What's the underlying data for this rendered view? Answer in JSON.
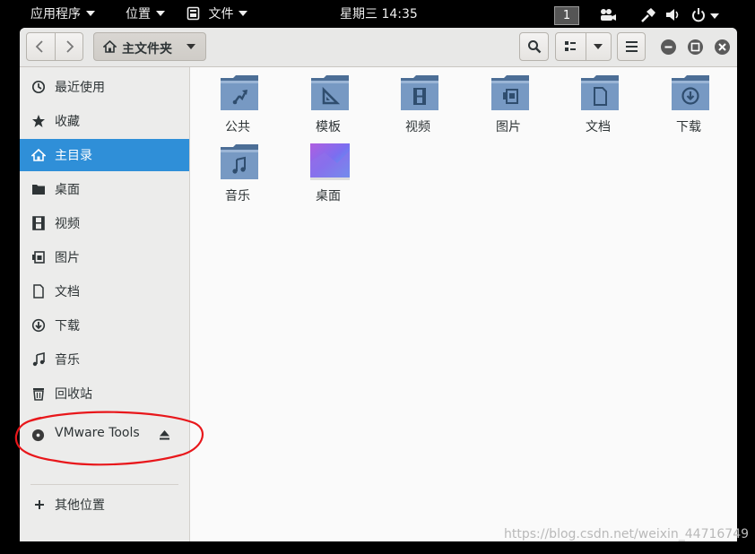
{
  "topbar": {
    "applications": "应用程序",
    "places": "位置",
    "files_app": "文件",
    "clock": "星期三 14:35",
    "workspace": "1"
  },
  "headerbar": {
    "path_label": "主文件夹"
  },
  "sidebar": {
    "items": [
      {
        "label": "最近使用",
        "icon": "clock-icon"
      },
      {
        "label": "收藏",
        "icon": "star-icon"
      },
      {
        "label": "主目录",
        "icon": "home-icon"
      },
      {
        "label": "桌面",
        "icon": "folder-icon"
      },
      {
        "label": "视频",
        "icon": "film-icon"
      },
      {
        "label": "图片",
        "icon": "picture-icon"
      },
      {
        "label": "文档",
        "icon": "document-icon"
      },
      {
        "label": "下载",
        "icon": "download-icon"
      },
      {
        "label": "音乐",
        "icon": "music-icon"
      },
      {
        "label": "回收站",
        "icon": "trash-icon"
      }
    ],
    "device": {
      "label": "VMware Tools",
      "icon": "disc-icon"
    },
    "other_locations": "其他位置"
  },
  "files": [
    {
      "label": "公共",
      "icon": "share-folder-icon"
    },
    {
      "label": "模板",
      "icon": "template-folder-icon"
    },
    {
      "label": "视频",
      "icon": "video-folder-icon"
    },
    {
      "label": "图片",
      "icon": "pictures-folder-icon"
    },
    {
      "label": "文档",
      "icon": "documents-folder-icon"
    },
    {
      "label": "下载",
      "icon": "downloads-folder-icon"
    },
    {
      "label": "音乐",
      "icon": "music-folder-icon"
    },
    {
      "label": "桌面",
      "icon": "desktop-folder-icon"
    }
  ],
  "colors": {
    "accent": "#2f8fd8",
    "folder": "#6b8fb9",
    "annotation": "#e8171b"
  },
  "watermark": "https://blog.csdn.net/weixin_44716749"
}
